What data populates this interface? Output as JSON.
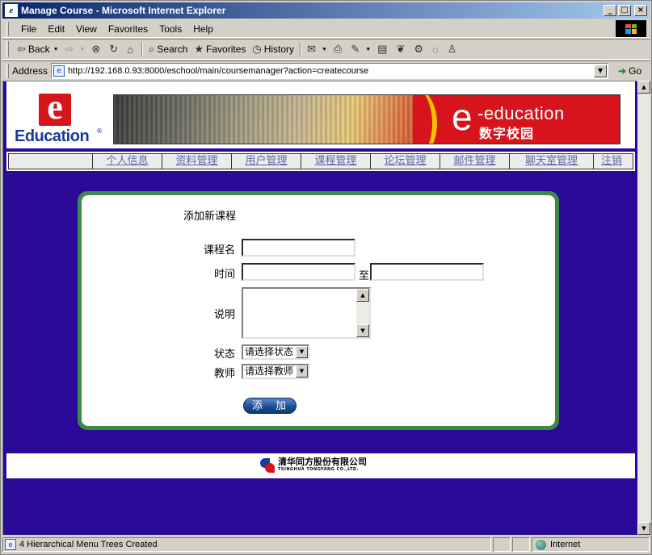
{
  "window": {
    "title": "Manage Course - Microsoft Internet Explorer",
    "app_icon": "ie-page-icon",
    "controls": [
      "_",
      "□",
      "×"
    ]
  },
  "menubar": {
    "items": [
      {
        "label": "File"
      },
      {
        "label": "Edit"
      },
      {
        "label": "View"
      },
      {
        "label": "Favorites"
      },
      {
        "label": "Tools"
      },
      {
        "label": "Help"
      }
    ]
  },
  "toolbar": {
    "back": "Back",
    "search": "Search",
    "favorites": "Favorites",
    "history": "History"
  },
  "address": {
    "label": "Address",
    "url": "http://192.168.0.93:8000/eschool/main/coursemanager?action=createcourse",
    "go": "Go"
  },
  "header": {
    "logo_text": "Education",
    "banner_text": "-education",
    "banner_cn": "数字校园",
    "banner_e": "e"
  },
  "nav": {
    "items": [
      {
        "label": "个人信息",
        "width": 86
      },
      {
        "label": "资料管理",
        "width": 86
      },
      {
        "label": "用户管理",
        "width": 86
      },
      {
        "label": "课程管理",
        "width": 86
      },
      {
        "label": "论坛管理",
        "width": 86
      },
      {
        "label": "邮件管理",
        "width": 86
      },
      {
        "label": "聊天室管理",
        "width": 104
      },
      {
        "label": "注销",
        "width": 48
      }
    ]
  },
  "form": {
    "title": "添加新课程",
    "course_name_label": "课程名",
    "course_name_value": "",
    "time_label": "时间",
    "time_start_value": "",
    "time_to": "至",
    "time_end_value": "",
    "description_label": "说明",
    "status_label": "状态",
    "status_selected": "请选择状态",
    "teacher_label": "教师",
    "teacher_selected": "请选择教师",
    "submit_label": "添 加"
  },
  "footer": {
    "company_cn": "清华同方股份有限公司",
    "company_en": "TSINGHUA TONGFANG CO.,LTD."
  },
  "statusbar": {
    "message": "4 Hierarchical Menu Trees Created",
    "zone": "Internet"
  }
}
